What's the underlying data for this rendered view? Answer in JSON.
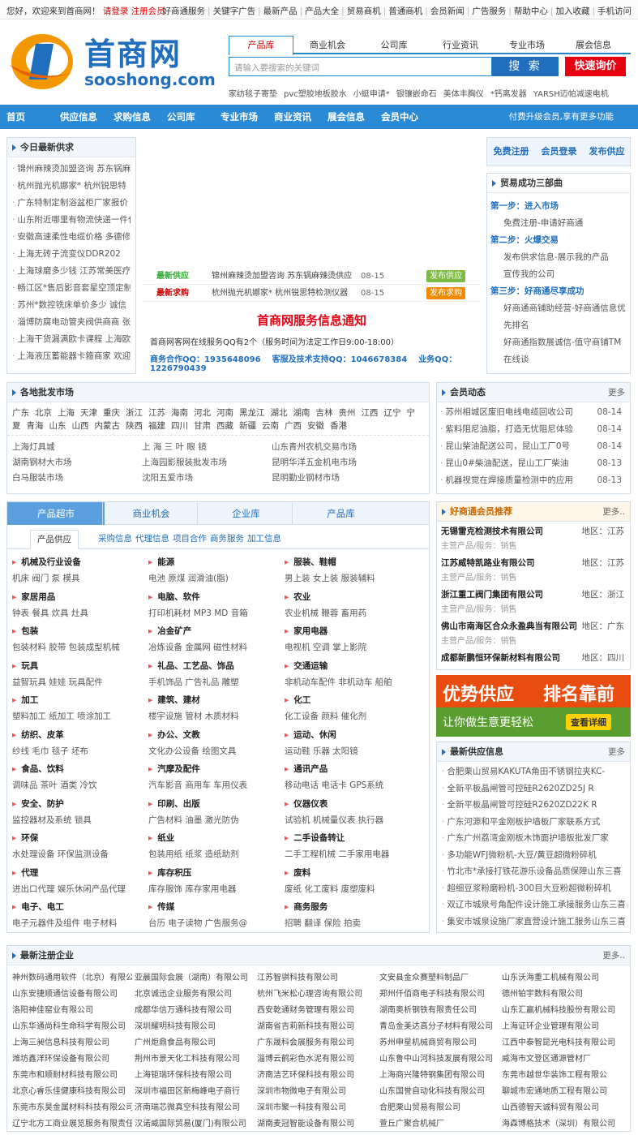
{
  "topbar": {
    "welcome": "您好，欢迎来到首商网！",
    "login": "请登录",
    "register": "注册会员",
    "links": [
      "好商通服务",
      "关键字广告",
      "最新产品",
      "产品大全",
      "贸易商机",
      "普通商机",
      "会员新闻",
      "广告服务",
      "帮助中心",
      "加入收藏",
      "手机访问"
    ]
  },
  "logo": {
    "cn": "首商网",
    "en": "sooshong.com"
  },
  "search": {
    "tabs": [
      "产品库",
      "商业机会",
      "公司库",
      "行业资讯",
      "专业市场",
      "展会信息"
    ],
    "placeholder": "请输入要搜索的关键词",
    "button": "搜 索",
    "ask": "快速询价"
  },
  "hot_keywords": [
    "家纺毯子寄垫",
    "pvc塑胶地板胶水",
    "小蜓申请*",
    "银镶嵌命石",
    "美体丰胸仪",
    "*钙离发器",
    "YARSH迈帕减速电机"
  ],
  "nav": {
    "items": [
      "首页",
      "供应信息",
      "求购信息",
      "公司库",
      "专业市场",
      "商业资讯",
      "展会信息",
      "会员中心"
    ],
    "right": "付费升级会员,享有更多功能"
  },
  "today_supply": {
    "title": "今日最新供求",
    "items": [
      "锦州麻辣烫加盟咨询 苏东锅麻",
      "杭州抛光机娜家* 杭州锐思特",
      "广东特制定制浴盆柜厂家报价",
      "山东附近哪里有物流快递一件代",
      "安徽高速柔性电缆价格 多德修",
      "上海无砖子流变仪DDR202",
      "上海球磨多少钱 江苏常美医疗",
      "畅江区*售后影音套星空顶定制",
      "苏州*数控铣床单价多少 诚信",
      "淄博防腐电动管夹阀供商商 张",
      "上海干货漏满欧卡课程 上海欧",
      "上海液压蓄能器卡箍商家 欢迎"
    ]
  },
  "latest_rows": [
    {
      "label": "最新供应",
      "text": "锦州麻辣烫加盟咨询 苏东锅麻辣烫供应",
      "date": "08-15",
      "tag": "发布供应"
    },
    {
      "label": "最新求购",
      "text": "杭州抛光机娜家* 杭州锐思特检测仪器",
      "date": "08-15",
      "tag": "发布求购"
    }
  ],
  "notice": {
    "title": "首商网服务信息通知",
    "line": "首商网客网在线服务QQ有2个（服务时间为法定工作日9:00-18:00）",
    "contacts": [
      "商务合作QQ：1935648096",
      "客服及技术支持QQ：1046678384",
      "业务QQ：1226790439"
    ]
  },
  "user_btns": [
    "免费注册",
    "会员登录",
    "发布供应"
  ],
  "steps": {
    "title": "贸易成功三部曲",
    "s1": "第一步：进入市场",
    "s1a": "免费注册-申请好商通",
    "s2": "第二步：火爆交易",
    "s2a": "发布供求信息-展示我的产品",
    "s2b": "宣传我的公司",
    "s3": "第三步：好商通尽享成功",
    "s3a": "好商通商铺助经营-好商通信息优先排名",
    "s3b": "好商通指数展诚信-值守商铺TM在线谈"
  },
  "wholesale": {
    "title": "各地批发市场",
    "regions": [
      "广东",
      "北京",
      "上海",
      "天津",
      "重庆",
      "浙江",
      "江苏",
      "海南",
      "河北",
      "河南",
      "黑龙江",
      "湖北",
      "湖南",
      "吉林",
      "贵州",
      "江西",
      "辽宁",
      "宁夏",
      "青海",
      "山东",
      "山西",
      "内蒙古",
      "陕西",
      "福建",
      "四川",
      "甘肃",
      "西藏",
      "新疆",
      "云南",
      "广西",
      "安徽",
      "香港"
    ],
    "markets": [
      "上海灯具城",
      "上 海 三 叶 眼 镜",
      "山东青州农机交易市场",
      "湖南钢材大市场",
      "上海园影服装批发市场",
      "昆明华洋五金机电市场",
      "白马服装市场",
      "沈阳五爱市场",
      "昆明勤业钢材市场"
    ]
  },
  "member_news": {
    "title": "会员动态",
    "more": "更多",
    "items": [
      {
        "t": "苏州相城区废旧电线电缆回收公司",
        "d": "08-14"
      },
      {
        "t": "紫料阻尼油脂，打造无忧阻尼体验",
        "d": "08-14"
      },
      {
        "t": "昆山柴油配送公司，昆山工厂0号",
        "d": "08-14"
      },
      {
        "t": "昆山0#柴油配送，昆山工厂柴油",
        "d": "08-13"
      },
      {
        "t": "机器视觉在焊接质量检测中的应用",
        "d": "08-13"
      }
    ]
  },
  "market_tabs": [
    "产品超市",
    "商业机会",
    "企业库",
    "产品库"
  ],
  "sub_tabs": [
    "产品供应",
    "采购信息",
    "代理信息",
    "项目合作",
    "商务服务",
    "加工信息"
  ],
  "categories": [
    {
      "h": "机械及行业设备",
      "s": "机床 阀门 泵 模具"
    },
    {
      "h": "能源",
      "s": "电池 原煤 润滑油(脂)"
    },
    {
      "h": "服装、鞋帽",
      "s": "男上装 女上装 服装辅料"
    },
    {
      "h": "家居用品",
      "s": "钟表 餐具 炊具 灶具"
    },
    {
      "h": "电脑、软件",
      "s": "打印机耗材 MP3 MD 音箱"
    },
    {
      "h": "农业",
      "s": "农业机械 鞭蓉 畜用药"
    },
    {
      "h": "包装",
      "s": "包装材料 胶带 包装成型机械"
    },
    {
      "h": "冶金矿产",
      "s": "冶炼设备 金属网 磁性材料"
    },
    {
      "h": "家用电器",
      "s": "电视机 空调 掌上影院"
    },
    {
      "h": "玩具",
      "s": "益智玩具 娃娃 玩具配件"
    },
    {
      "h": "礼品、工艺品、饰品",
      "s": "手机饰品 广告礼品 雕塑"
    },
    {
      "h": "交通运输",
      "s": "非机动车配件 非机动车 船舶"
    },
    {
      "h": "加工",
      "s": "塑料加工 纸加工 喷涂加工"
    },
    {
      "h": "建筑、建材",
      "s": "楼宇设施 管材 木质材料"
    },
    {
      "h": "化工",
      "s": "化工设备 颜料 催化剂"
    },
    {
      "h": "纺织、皮革",
      "s": "纱线 毛巾 毯子 坯布"
    },
    {
      "h": "办公、文教",
      "s": "文化办公设备 绘图文具"
    },
    {
      "h": "运动、休闲",
      "s": "运动鞋 乐器 太阳镜"
    },
    {
      "h": "食品、饮料",
      "s": "调味品 茶叶 酒类 冷饮"
    },
    {
      "h": "汽摩及配件",
      "s": "汽车影音 商用车 车用仪表"
    },
    {
      "h": "通讯产品",
      "s": "移动电话 电话卡 GPS系统"
    },
    {
      "h": "安全、防护",
      "s": "监控器材及系统 锁具"
    },
    {
      "h": "印刷、出版",
      "s": "广告材料 油墨 激光防伪"
    },
    {
      "h": "仪器仪表",
      "s": "试验机 机械量仪表 执行器"
    },
    {
      "h": "环保",
      "s": "水处理设备 环保监测设备"
    },
    {
      "h": "纸业",
      "s": "包装用纸 纸浆 造纸助剂"
    },
    {
      "h": "二手设备转让",
      "s": "二手工程机械 二手家用电器"
    },
    {
      "h": "代理",
      "s": "进出口代理 娱乐休闲产品代理"
    },
    {
      "h": "库存积压",
      "s": "库存服饰 库存家用电器"
    },
    {
      "h": "废料",
      "s": "废纸 化工废料 废塑废料"
    },
    {
      "h": "电子、电工",
      "s": "电子元器件及组件 电子材料"
    },
    {
      "h": "传媒",
      "s": "台历 电子读物 广告服务@"
    },
    {
      "h": "商务服务",
      "s": "招聘 翻译 保险 拍卖"
    }
  ],
  "good_members": {
    "title": "好商通会员推荐",
    "more": "更多..",
    "items": [
      {
        "name": "无锡雷克检测技术有限公司",
        "area": "地区：江苏",
        "prod": "主营产品/服务：销售"
      },
      {
        "name": "江苏威特凯路业有限公司",
        "area": "地区：江苏",
        "prod": "主营产品/服务：销售"
      },
      {
        "name": "浙江重工阀门集团有限公司",
        "area": "地区：浙江",
        "prod": "主营产品/服务：销售"
      },
      {
        "name": "佛山市南海区合众永盈典当有限公司",
        "area": "地区：广东",
        "prod": "主营产品/服务：销售"
      },
      {
        "name": "成都新鹏恒环保新材料有限公司",
        "area": "地区：四川",
        "prod": ""
      }
    ]
  },
  "ad": {
    "l1": "优势供应",
    "l2": "排名靠前",
    "l3": "让你做生意更轻松",
    "btn": "查看详细"
  },
  "latest_supply": {
    "title": "最新供应信息",
    "more": "更多",
    "items": [
      "合肥栗山贸易KAKUTA角田不锈钢拉夹KC-",
      "全新平板晶闸管可控硅R2620ZD25J R",
      "全新平板晶闸管可控硅R2620ZD22K R",
      "广东河源和平金刚板护墙板厂家联系方式",
      "广东广州荔湾金刚板木饰面护墙板批发厂家",
      "多功能WFJ微粉机-大豆/黄豆超微粉碎机",
      "竹北市*承接打铁花游乐设备品质保障山东三喜",
      "超细豆浆粉磨粉机-300目大豆粉超微粉碎机",
      "双辽市城泉号角配件设计施工承接服务山东三喜",
      "集安市城泉设施厂家直营设计施工服务山东三喜"
    ]
  },
  "new_companies": {
    "title": "最新注册企业",
    "more": "更多..",
    "items": [
      "神州数码通用软件（北京）有限公",
      "亚晨国际会展（湖南）有限公司",
      "江苏智骐科技有限公司",
      "文安县金众赛塑料制品厂",
      "山东沃海重工机械有限公司",
      "山东安捷顺通信设备有限公司",
      "北京诚迅企业服务有限公司",
      "杭州飞米松心理咨询有限公司",
      "郑州仟佰商电子科技有限公司",
      "德州铂宇数科有限公司",
      "洛阳神佳窑业有限公司",
      "成都华信万通科技有限公司",
      "西安乾通财务管理有限公司",
      "湖南奥析钢铁有限责任公司",
      "山东汇赢机械科技股份有限公司",
      "山东华通尚科生命科学有限公司",
      "深圳耀明科技有限公司",
      "湖南省吉莉新科技有限公司",
      "青岛金美达高分子材料有限公司",
      "上海证环企业管理有限公司",
      "上海三昶信息科技有限公司",
      "广州炬鼎食品有限公司",
      "广东晟科会展服务有限公司",
      "苏州申星机械商贸有限公司",
      "江西中泰智昆光电科技有限公司",
      "潍坊鑫洋环保设备有限公司",
      "荆州市景天化工科技有限公司",
      "淄博云鹤彩色水泥有限公司",
      "山东鲁中山河科技发展有限公司",
      "威海市文登区通源管材厂",
      "东莞市和顺耐材科技有限公司",
      "上海钜瑞环保科技有限公司",
      "济南洁艺环保科技有限公司",
      "上海商兴隆特钢集团有限公司",
      "东莞市越世华装饰工程有限公",
      "北京心睿乐佳健康科技有限公司",
      "深圳市福田区新梅峰电子商行",
      "深圳市物微电子有限公司",
      "山东国誉自动化科技有限公司",
      "聊城市宏通地质工程有限公司",
      "东莞市东昊金属材料科技有限公司",
      "济南瑞芯微真空科技有限公司",
      "深圳市聚一科技有限公司",
      "合肥栗山贸易有限公司",
      "山西德智天诚科贸有限公司",
      "辽宁北方工商业展览服务有限责任",
      "汉诺威国际贸易(厦门)有限公司",
      "湖南麦冠智能设备有限公司",
      "萱丘广聚合机械厂",
      "海森博格技术（深圳）有限公司"
    ]
  },
  "colors": {
    "nav": "#2b8ad6",
    "accent": "#2586c8",
    "red": "#e60012"
  }
}
